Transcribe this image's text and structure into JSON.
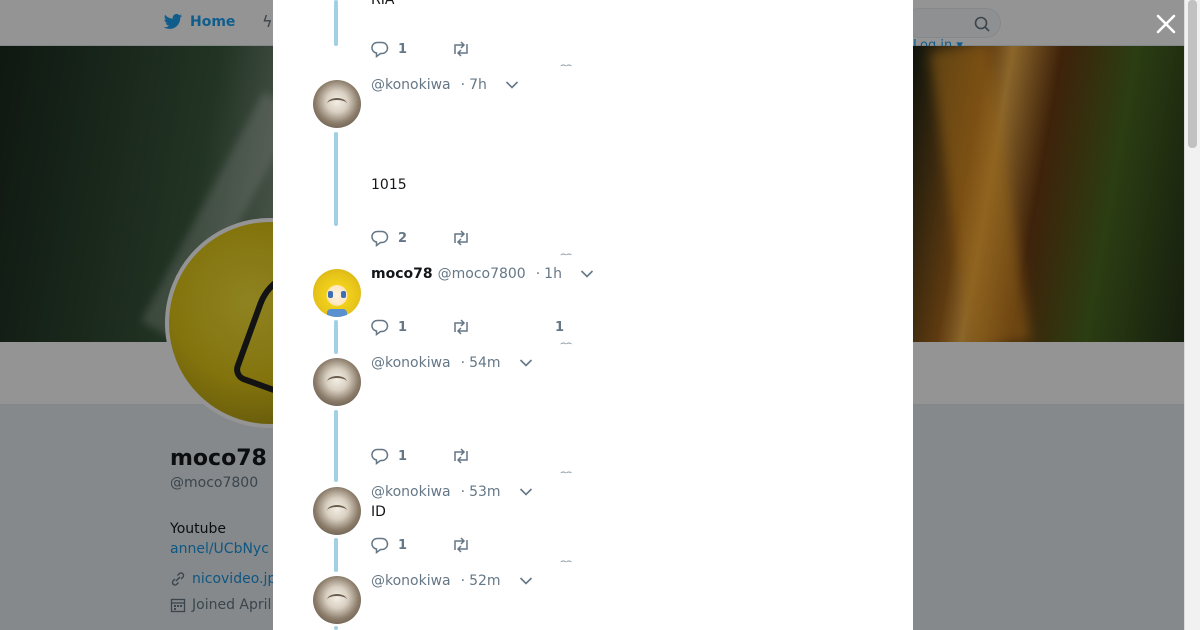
{
  "nav": {
    "home_label": "Home",
    "login_label": "Log in"
  },
  "profile": {
    "name": "moco78",
    "handle": "@moco7800",
    "bio": "Youtube",
    "bio_link": "annel/UCbNyc",
    "website": "nicovideo.jp",
    "joined": "Joined April"
  },
  "thread": {
    "top_text": "RIA",
    "tweets": [
      {
        "display_name": "",
        "username": "@konokiwa",
        "sep": "·",
        "time": "7h",
        "text": "1015",
        "replies": "1",
        "avatar": "cat-avatar"
      },
      {
        "display_name": "moco78",
        "username": "@moco7800",
        "sep": "·",
        "time": "1h",
        "text": "",
        "replies": "2",
        "avatar": "anime-avatar"
      },
      {
        "display_name": "",
        "username": "@konokiwa",
        "sep": "·",
        "time": "54m",
        "text": "",
        "replies": "1",
        "likes": "1",
        "avatar": "cat-avatar"
      },
      {
        "display_name": "",
        "username": "@konokiwa",
        "sep": "·",
        "time": "53m",
        "text": "ID",
        "replies": "1",
        "avatar": "cat-avatar"
      },
      {
        "display_name": "",
        "username": "@konokiwa",
        "sep": "·",
        "time": "52m",
        "text": "",
        "replies": "1",
        "avatar": "cat-avatar"
      }
    ],
    "first_actions": {
      "replies": "1"
    },
    "more_glyph": "⌢⌢"
  },
  "colors": {
    "accent": "#1da1f2",
    "thread_line": "#9fd0e6",
    "muted": "#657786"
  }
}
